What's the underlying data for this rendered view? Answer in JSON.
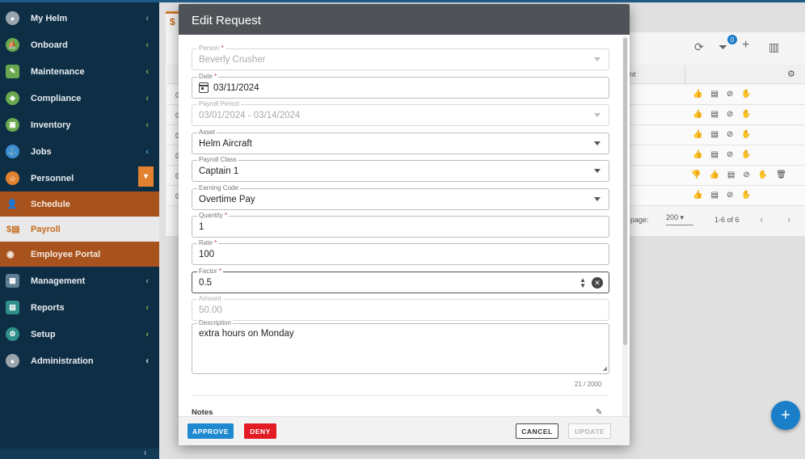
{
  "sidebar": {
    "items": [
      {
        "label": "My Helm",
        "icon": "user-circle-icon",
        "chevron": "chev-gray"
      },
      {
        "label": "Onboard",
        "icon": "boat-icon",
        "chevron": "chev-green"
      },
      {
        "label": "Maintenance",
        "icon": "wrench-icon",
        "chevron": "chev-green"
      },
      {
        "label": "Compliance",
        "icon": "shield-icon",
        "chevron": "chev-green"
      },
      {
        "label": "Inventory",
        "icon": "box-icon",
        "chevron": "chev-green"
      },
      {
        "label": "Jobs",
        "icon": "ship-icon",
        "chevron": "chev-blue"
      },
      {
        "label": "Personnel",
        "icon": "people-icon",
        "chevron": "toggle"
      }
    ],
    "sub_items": [
      {
        "label": "Schedule",
        "icon": "schedule-icon"
      },
      {
        "label": "Payroll",
        "icon": "payroll-icon"
      },
      {
        "label": "Employee Portal",
        "icon": "employee-icon"
      }
    ],
    "lower_items": [
      {
        "label": "Management",
        "icon": "grid-icon"
      },
      {
        "label": "Reports",
        "icon": "report-icon"
      },
      {
        "label": "Setup",
        "icon": "cog-icon"
      },
      {
        "label": "Administration",
        "icon": "admin-icon"
      }
    ],
    "colors": {
      "background": "#0e2e45",
      "accent": "#a8531e"
    }
  },
  "background": {
    "tab_label": "$",
    "filter_count": "0",
    "header_col": "nt",
    "rows": [
      {
        "cell": "0",
        "has_down": false,
        "has_delete": false
      },
      {
        "cell": "0",
        "has_down": false,
        "has_delete": false
      },
      {
        "cell": "0",
        "has_down": false,
        "has_delete": false
      },
      {
        "cell": "0",
        "has_down": false,
        "has_delete": false
      },
      {
        "cell": "0",
        "has_down": true,
        "has_delete": true
      },
      {
        "cell": "0",
        "has_down": false,
        "has_delete": false
      }
    ],
    "pager": {
      "label": "page:",
      "per_page": "200",
      "range": "1-6 of 6"
    }
  },
  "modal": {
    "title": "Edit Request",
    "fields": {
      "person": {
        "label": "Person",
        "value": "Beverly Crusher"
      },
      "date": {
        "label": "Date",
        "value": "03/11/2024"
      },
      "payroll_period": {
        "label": "Payroll Period",
        "value": "03/01/2024 - 03/14/2024"
      },
      "asset": {
        "label": "Asset",
        "value": "Helm Aircraft"
      },
      "payroll_class": {
        "label": "Payroll Class",
        "value": "Captain 1"
      },
      "earning_code": {
        "label": "Earning Code",
        "value": "Overtime Pay"
      },
      "quantity": {
        "label": "Quantity",
        "value": "1"
      },
      "rate": {
        "label": "Rate",
        "value": "100"
      },
      "factor": {
        "label": "Factor",
        "value": "0.5"
      },
      "amount": {
        "label": "Amount",
        "value": "50.00"
      },
      "description": {
        "label": "Description",
        "value": "extra hours on Monday"
      }
    },
    "char_counter": "21 / 2000",
    "notes_label": "Notes",
    "buttons": {
      "approve": "APPROVE",
      "deny": "DENY",
      "cancel": "CANCEL",
      "update": "UPDATE"
    }
  }
}
